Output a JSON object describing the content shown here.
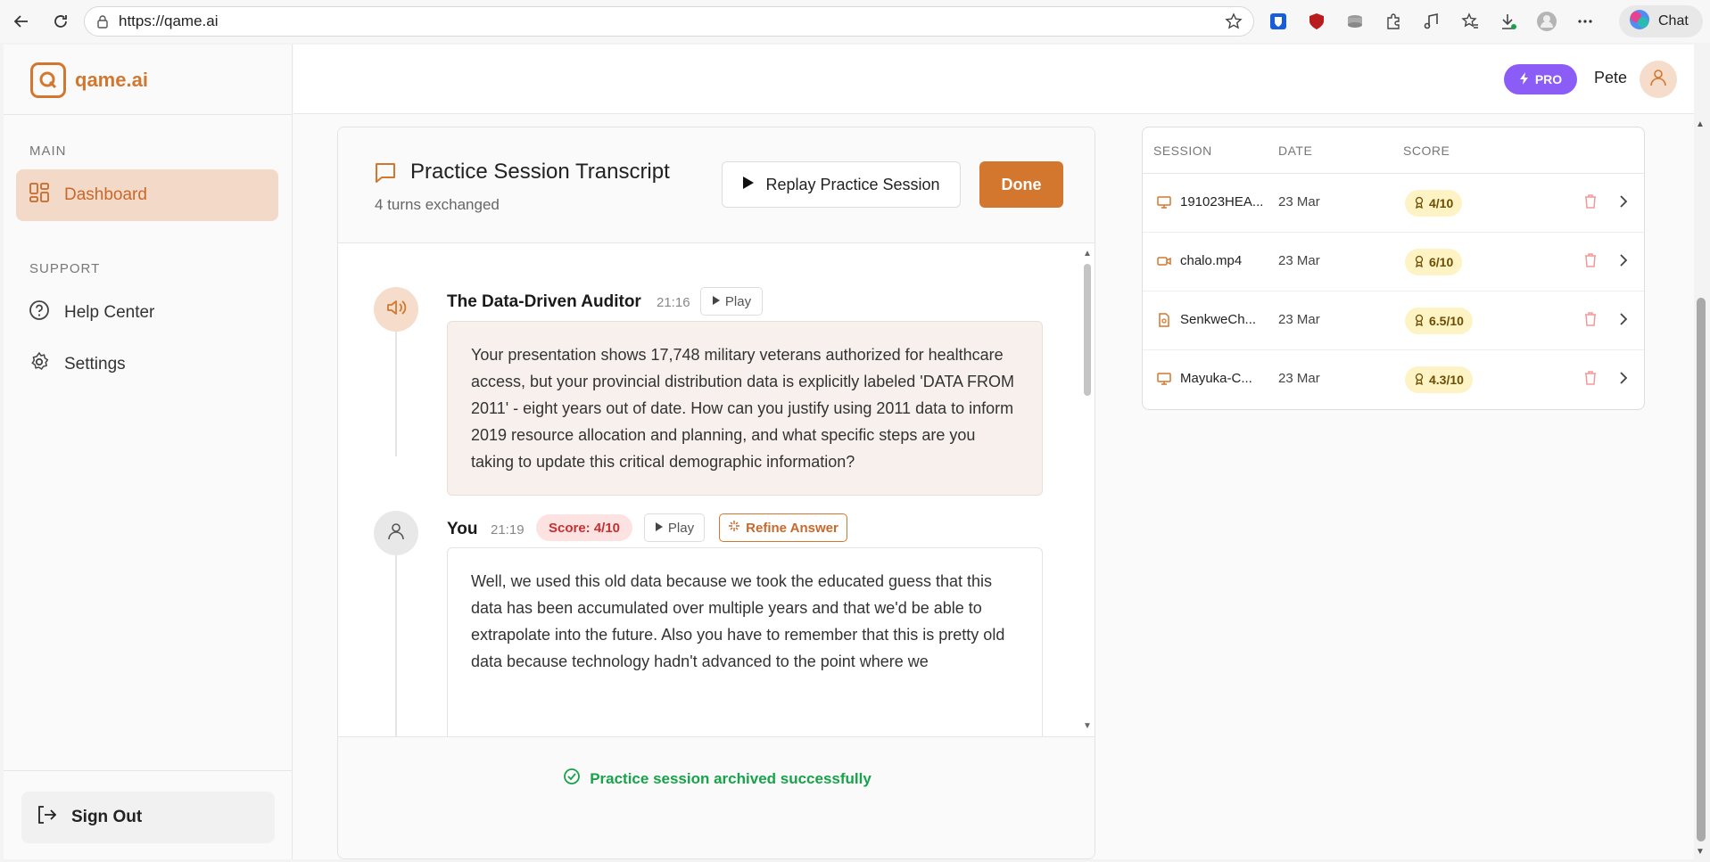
{
  "browser": {
    "url": "https://qame.ai",
    "chat_label": "Chat"
  },
  "app": {
    "logo_text": "qame.ai",
    "pro_label": "PRO",
    "user_name": "Pete"
  },
  "sidebar": {
    "main_label": "MAIN",
    "support_label": "SUPPORT",
    "items": [
      {
        "label": "Dashboard",
        "icon": "dashboard-icon"
      },
      {
        "label": "Help Center",
        "icon": "help-icon"
      },
      {
        "label": "Settings",
        "icon": "gear-icon"
      }
    ],
    "sign_out": "Sign Out"
  },
  "transcript": {
    "title": "Practice Session Transcript",
    "subtitle": "4 turns exchanged",
    "replay_label": "Replay Practice Session",
    "done_label": "Done",
    "messages": [
      {
        "author": "The Data-Driven Auditor",
        "time": "21:16",
        "play_label": "Play",
        "text": "Your presentation shows 17,748 military veterans authorized for healthcare access, but your provincial distribution data is explicitly labeled 'DATA FROM 2011' - eight years out of date. How can you justify using 2011 data to inform 2019 resource allocation and planning, and what specific steps are you taking to update this critical demographic information?"
      },
      {
        "author": "You",
        "time": "21:19",
        "score": "Score: 4/10",
        "play_label": "Play",
        "refine_label": "Refine Answer",
        "text": "Well, we used this old data because we took the educated guess that this data has been accumulated over multiple years and that we'd be able to extrapolate into the future. Also you have to remember that this is pretty old data because technology hadn't advanced to the point where we"
      }
    ],
    "archived_message": "Practice session archived successfully"
  },
  "sessions": {
    "headers": {
      "session": "SESSION",
      "date": "DATE",
      "score": "SCORE"
    },
    "rows": [
      {
        "name": "191023HEA...",
        "date": "23 Mar",
        "score": "4/10",
        "icon": "presentation-icon"
      },
      {
        "name": "chalo.mp4",
        "date": "23 Mar",
        "score": "6/10",
        "icon": "video-icon"
      },
      {
        "name": "SenkweCh...",
        "date": "23 Mar",
        "score": "6.5/10",
        "icon": "document-icon"
      },
      {
        "name": "Mayuka-C...",
        "date": "23 Mar",
        "score": "4.3/10",
        "icon": "presentation-icon"
      }
    ]
  },
  "colors": {
    "accent": "#d4772e",
    "pro": "#8b5cf6",
    "success": "#16a34a",
    "score_bad": "#c53030"
  }
}
